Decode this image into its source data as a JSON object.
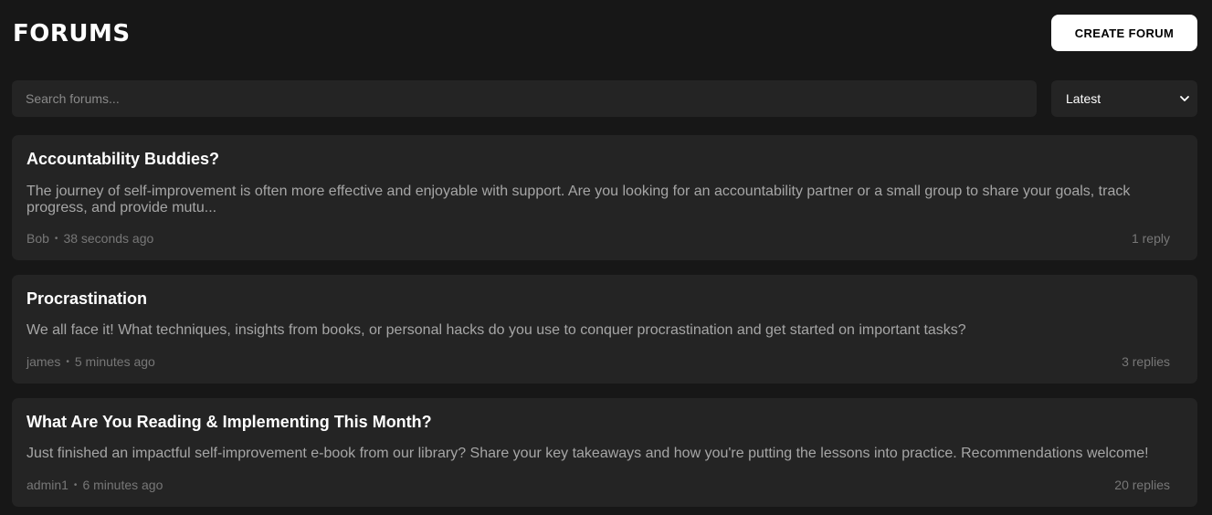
{
  "header": {
    "title": "FORUMS",
    "create_label": "CREATE FORUM"
  },
  "search": {
    "placeholder": "Search forums...",
    "value": ""
  },
  "sort": {
    "selected": "Latest"
  },
  "forums": [
    {
      "title": "Accountability Buddies?",
      "excerpt": "The journey of self-improvement is often more effective and enjoyable with support. Are you looking for an accountability partner or a small group to share your goals, track progress, and provide mutu...",
      "author": "Bob",
      "separator": "•",
      "time": "38 seconds ago",
      "replies": "1 reply"
    },
    {
      "title": "Procrastination",
      "excerpt": "We all face it! What techniques, insights from books, or personal hacks do you use to conquer procrastination and get started on important tasks?",
      "author": "james",
      "separator": "•",
      "time": "5 minutes ago",
      "replies": "3 replies"
    },
    {
      "title": "What Are You Reading & Implementing This Month?",
      "excerpt": "Just finished an impactful self-improvement e-book from our library? Share your key takeaways and how you're putting the lessons into practice. Recommendations welcome!",
      "author": "admin1",
      "separator": "•",
      "time": "6 minutes ago",
      "replies": "20 replies"
    }
  ],
  "colors": {
    "background": "#171717",
    "card": "#242424",
    "accent": "#ffffff"
  },
  "icons": {
    "sort": "chevron-down-icon"
  }
}
